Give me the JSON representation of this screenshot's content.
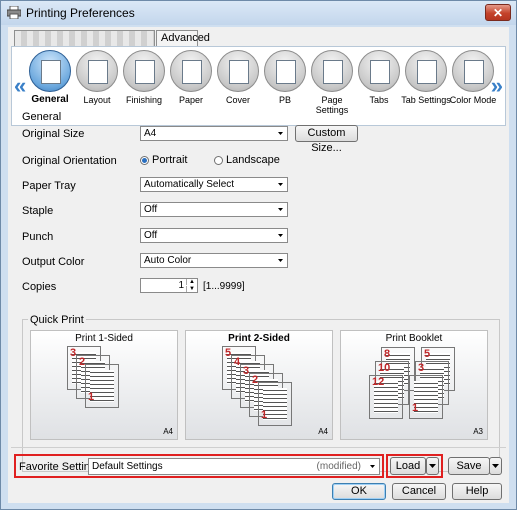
{
  "window": {
    "title": "Printing Preferences",
    "close_label": "✕"
  },
  "tabs": {
    "tab1_label": "",
    "advanced_label": "Advanced"
  },
  "ribbon": [
    {
      "label": "General",
      "icon": "general-icon"
    },
    {
      "label": "Layout",
      "icon": "layout-icon"
    },
    {
      "label": "Finishing",
      "icon": "finishing-icon"
    },
    {
      "label": "Paper",
      "icon": "paper-icon"
    },
    {
      "label": "Cover",
      "icon": "cover-icon"
    },
    {
      "label": "PB",
      "icon": "pb-icon"
    },
    {
      "label": "Page Settings",
      "icon": "page-settings-icon"
    },
    {
      "label": "Tabs",
      "icon": "tabs-icon"
    },
    {
      "label": "Tab Settings",
      "icon": "tab-settings-icon"
    },
    {
      "label": "Color Mode",
      "icon": "color-mode-icon"
    }
  ],
  "general": {
    "section_label": "General",
    "original_size_label": "Original Size",
    "original_size_value": "A4",
    "custom_size_button": "Custom Size...",
    "orientation_label": "Original Orientation",
    "portrait_label": "Portrait",
    "landscape_label": "Landscape",
    "paper_tray_label": "Paper Tray",
    "paper_tray_value": "Automatically Select",
    "staple_label": "Staple",
    "staple_value": "Off",
    "punch_label": "Punch",
    "punch_value": "Off",
    "output_color_label": "Output Color",
    "output_color_value": "Auto Color",
    "copies_label": "Copies",
    "copies_value": "1",
    "copies_range": "[1...9999]"
  },
  "quick_print": {
    "label": "Quick Print",
    "cards": [
      {
        "label": "Print 1-Sided",
        "size": "A4",
        "pages": [
          "3",
          "2",
          "1"
        ]
      },
      {
        "label": "Print 2-Sided",
        "size": "A4",
        "pages": [
          "5",
          "4",
          "3",
          "2",
          "1"
        ]
      },
      {
        "label": "Print Booklet",
        "size": "A3",
        "pages": [
          "8",
          "5",
          "10",
          "3",
          "12",
          "1"
        ]
      }
    ]
  },
  "favorite": {
    "label": "Favorite Setting",
    "value": "Default Settings",
    "modified": "(modified)",
    "load_button": "Load",
    "save_button": "Save"
  },
  "buttons": {
    "ok": "OK",
    "cancel": "Cancel",
    "help": "Help"
  }
}
